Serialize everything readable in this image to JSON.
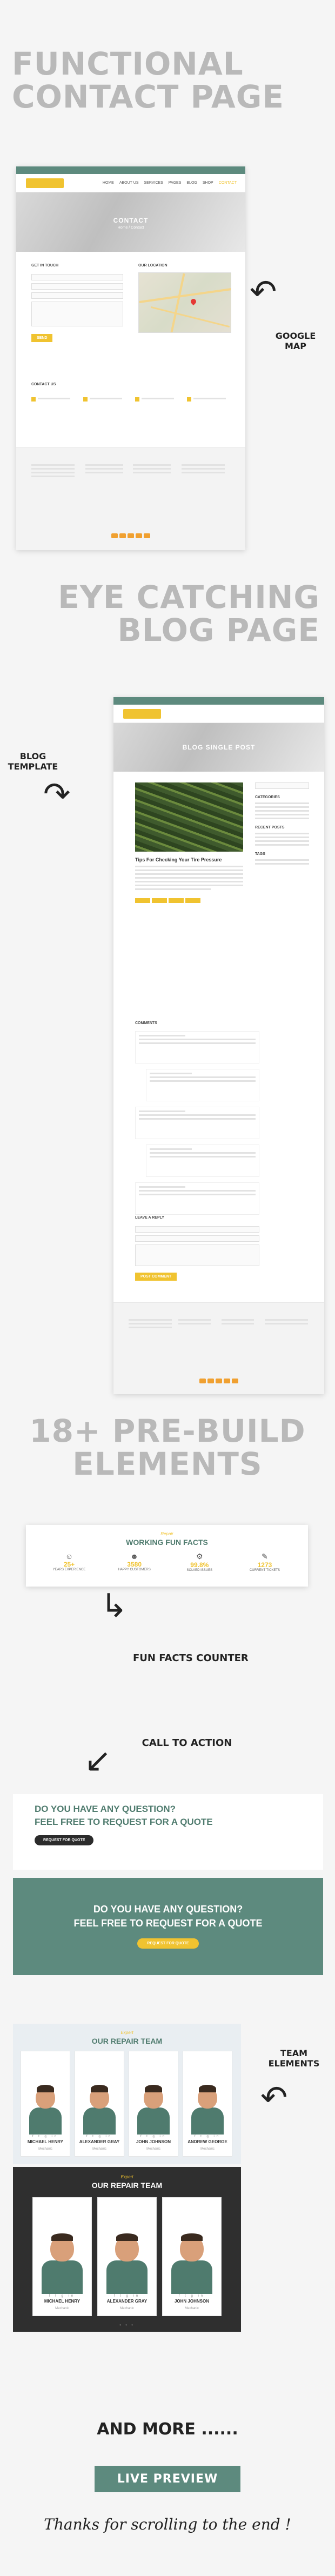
{
  "headings": {
    "contact": [
      "FUNCTIONAL",
      "CONTACT PAGE"
    ],
    "blog": [
      "EYE CATCHING",
      "BLOG PAGE"
    ],
    "elements": [
      "18+ PRE-BUILD",
      "ELEMENTS"
    ],
    "more": "AND MORE ......",
    "thanks": "Thanks for scrolling to the end !"
  },
  "callouts": {
    "google_map": [
      "GOOGLE",
      "MAP"
    ],
    "blog_template": [
      "BLOG",
      "TEMPLATE"
    ],
    "fun_facts_counter": "FUN FACTS COUNTER",
    "call_to_action": "CALL TO ACTION",
    "team_elements": [
      "TEAM",
      "ELEMENTS"
    ]
  },
  "contact_mock": {
    "page_title": "CONTACT",
    "breadcrumb": "Home / Contact",
    "form_title": "GET IN TOUCH",
    "location_title": "OUR LOCATION",
    "submit": "SEND",
    "info_title": "CONTACT US",
    "nav": [
      "HOME",
      "ABOUT US",
      "SERVICES",
      "PAGES",
      "BLOG",
      "SHOP",
      "CONTACT"
    ]
  },
  "blog_mock": {
    "page_title": "BLOG SINGLE POST",
    "post_title": "Tips For Checking Your Tire Pressure",
    "sidebar": [
      "Categories",
      "Recent Posts",
      "Tags"
    ],
    "comments_title": "Comments",
    "reply_title": "Leave a Reply",
    "submit": "POST COMMENT"
  },
  "fun_facts": {
    "kicker": "Repair",
    "title": "WORKING FUN FACTS",
    "items": [
      {
        "value": "25+",
        "label": "YEARS EXPERIENCE"
      },
      {
        "value": "3580",
        "label": "HAPPY CUSTOMERS"
      },
      {
        "value": "99.8%",
        "label": "SOLVED ISSUES"
      },
      {
        "value": "1273",
        "label": "CURRENT TICKETS"
      }
    ]
  },
  "cta": {
    "light": {
      "line1": "DO YOU HAVE ANY QUESTION?",
      "line2": "FEEL FREE TO REQUEST FOR A QUOTE",
      "button": "REQUEST FOR QUOTE"
    },
    "dark": {
      "line1": "DO YOU HAVE ANY QUESTION?",
      "line2": "FEEL FREE TO REQUEST FOR A QUOTE",
      "button": "REQUEST FOR QUOTE"
    }
  },
  "team": {
    "kicker": "Expert",
    "title": "OUR REPAIR TEAM",
    "light_members": [
      {
        "name": "MICHAEL HENRY",
        "role": "Mechanic"
      },
      {
        "name": "ALEXANDER GRAY",
        "role": "Mechanic"
      },
      {
        "name": "JOHN JOHNSON",
        "role": "Mechanic"
      },
      {
        "name": "ANDREW GEORGE",
        "role": "Mechanic"
      }
    ],
    "dark_members": [
      {
        "name": "MICHAEL HENRY",
        "role": "Mechanic"
      },
      {
        "name": "ALEXANDER GRAY",
        "role": "Mechanic"
      },
      {
        "name": "JOHN JOHNSON",
        "role": "Mechanic"
      }
    ]
  },
  "live_preview": "LIVE PREVIEW",
  "colors": {
    "accent": "#f0c330",
    "teal": "#5d8a7e",
    "heading_gray": "#b9b9b9",
    "dark": "#2f2f2f"
  }
}
